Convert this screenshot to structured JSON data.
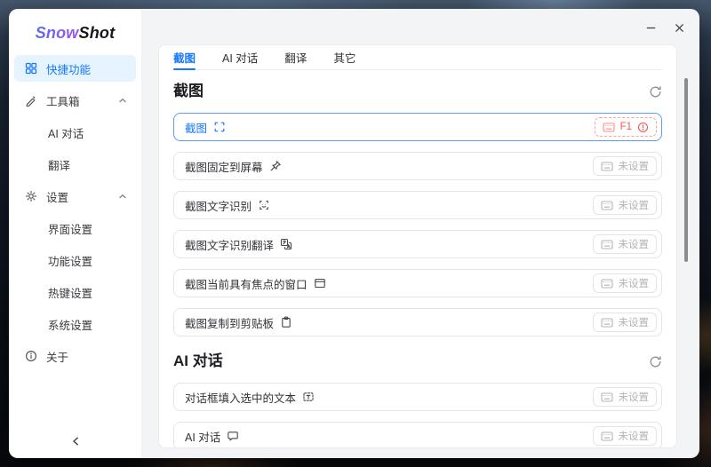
{
  "app": {
    "logo_prefix": "Snow",
    "logo_suffix": "Shot"
  },
  "window_controls": {
    "minimize_icon": "minimize",
    "close_icon": "close"
  },
  "sidebar": {
    "active_item": "快捷功能",
    "items": [
      {
        "label": "快捷功能",
        "icon": "grid-icon",
        "type": "item",
        "active": true
      },
      {
        "label": "工具箱",
        "icon": "tool-icon",
        "type": "group",
        "expanded": true
      },
      {
        "label": "AI 对话",
        "type": "subitem"
      },
      {
        "label": "翻译",
        "type": "subitem"
      },
      {
        "label": "设置",
        "icon": "gear-icon",
        "type": "group",
        "expanded": true
      },
      {
        "label": "界面设置",
        "type": "subitem"
      },
      {
        "label": "功能设置",
        "type": "subitem"
      },
      {
        "label": "热键设置",
        "type": "subitem"
      },
      {
        "label": "系统设置",
        "type": "subitem"
      },
      {
        "label": "关于",
        "icon": "info-icon",
        "type": "item"
      }
    ]
  },
  "tabs": [
    {
      "label": "截图",
      "active": true
    },
    {
      "label": "AI 对话",
      "active": false
    },
    {
      "label": "翻译",
      "active": false
    },
    {
      "label": "其它",
      "active": false
    }
  ],
  "sections": [
    {
      "title": "截图",
      "rows": [
        {
          "label": "截图",
          "icon": "screenshot-icon",
          "hotkey": "F1",
          "state": "error",
          "selected": true
        },
        {
          "label": "截图固定到屏幕",
          "icon": "pin-icon",
          "hotkey": "未设置",
          "state": "unset"
        },
        {
          "label": "截图文字识别",
          "icon": "ocr-icon",
          "hotkey": "未设置",
          "state": "unset"
        },
        {
          "label": "截图文字识别翻译",
          "icon": "translate-icon",
          "hotkey": "未设置",
          "state": "unset"
        },
        {
          "label": "截图当前具有焦点的窗口",
          "icon": "window-icon",
          "hotkey": "未设置",
          "state": "unset"
        },
        {
          "label": "截图复制到剪贴板",
          "icon": "clipboard-icon",
          "hotkey": "未设置",
          "state": "unset"
        }
      ]
    },
    {
      "title": "AI 对话",
      "rows": [
        {
          "label": "对话框填入选中的文本",
          "icon": "text-insert-icon",
          "hotkey": "未设置",
          "state": "unset"
        },
        {
          "label": "AI 对话",
          "icon": "chat-icon",
          "hotkey": "未设置",
          "state": "unset"
        }
      ]
    }
  ],
  "colors": {
    "primary": "#1677ff",
    "primary_bg": "#e6f4ff",
    "selected_border": "#5a9cf8",
    "error": "#f5564e",
    "error_border": "#ff9f9a",
    "unset_text": "#b4b4b8",
    "logo_gradient_start": "#5a6cf3",
    "logo_gradient_end": "#a252f0"
  }
}
